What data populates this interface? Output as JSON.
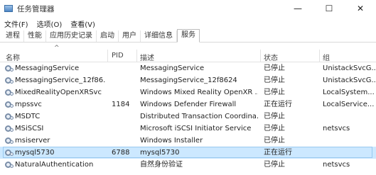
{
  "window": {
    "title": "任务管理器",
    "minimize": "—",
    "maximize": "☐",
    "close": "✕"
  },
  "menu": [
    "文件(F)",
    "选项(O)",
    "查看(V)"
  ],
  "tabs": [
    "进程",
    "性能",
    "应用历史记录",
    "启动",
    "用户",
    "详细信息",
    "服务"
  ],
  "active_tab": "服务",
  "columns": {
    "name": "名称",
    "pid": "PID",
    "description": "描述",
    "status": "状态",
    "group": "组"
  },
  "services": [
    {
      "name": "MessagingService",
      "pid": "",
      "description": "MessagingService",
      "status": "已停止",
      "group": "UnistackSvcG..."
    },
    {
      "name": "MessagingService_12f86...",
      "pid": "",
      "description": "MessagingService_12f8624",
      "status": "已停止",
      "group": "UnistackSvcG..."
    },
    {
      "name": "MixedRealityOpenXRSvc",
      "pid": "",
      "description": "Windows Mixed Reality OpenXR ...",
      "status": "已停止",
      "group": "LocalSystem..."
    },
    {
      "name": "mpssvc",
      "pid": "1184",
      "description": "Windows Defender Firewall",
      "status": "正在运行",
      "group": "LocalService..."
    },
    {
      "name": "MSDTC",
      "pid": "",
      "description": "Distributed Transaction Coordina...",
      "status": "已停止",
      "group": ""
    },
    {
      "name": "MSiSCSI",
      "pid": "",
      "description": "Microsoft iSCSI Initiator Service",
      "status": "已停止",
      "group": "netsvcs"
    },
    {
      "name": "msiserver",
      "pid": "",
      "description": "Windows Installer",
      "status": "已停止",
      "group": ""
    },
    {
      "name": "mysql5730",
      "pid": "6788",
      "description": "mysql5730",
      "status": "正在运行",
      "group": ""
    },
    {
      "name": "NaturalAuthentication",
      "pid": "",
      "description": "自然身份验证",
      "status": "已停止",
      "group": "netsvcs"
    }
  ],
  "selected_service": "mysql5730"
}
